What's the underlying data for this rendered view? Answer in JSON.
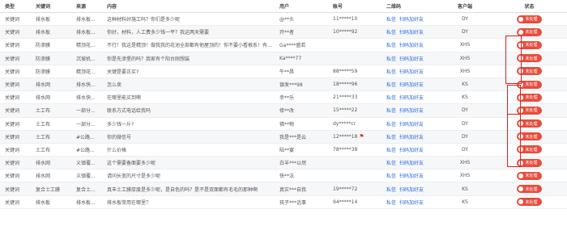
{
  "headers": {
    "type": "类型",
    "keyword": "关键词",
    "source": "来源",
    "content": "内容",
    "user": "用户",
    "account": "账号",
    "qrcode": "二维码",
    "client": "客户端",
    "status": "状态"
  },
  "actions": {
    "msg": "私信",
    "scan": "扫码加好友"
  },
  "status_label": "未处理",
  "highlight_color": "#e02020",
  "rows": [
    {
      "type": "关键词",
      "keyword": "排水板",
      "source": "排水板...",
      "content": "这种材料好施工吗？你们是多少呢",
      "user": "@**头",
      "account": "11*****10",
      "client": "DY"
    },
    {
      "type": "关键词",
      "keyword": "排水板",
      "source": "排水板...",
      "content": "你好，材料，人工费多少钱一平？我这两天需要",
      "user": "开**者",
      "account": "10*****92",
      "client": "DY"
    },
    {
      "type": "关键词",
      "keyword": "防渗膜",
      "source": "精顶花...",
      "content": "不行！我这是精顶！做我我的花池全部都有他屋顶的！你不要小看根系！有个商品房的精顶，一个房主他花了好多钱给吉...",
      "user": "Ga****盛若",
      "account": "",
      "client": "XHS"
    },
    {
      "type": "关键词",
      "keyword": "防渗膜",
      "source": "沉坡机...",
      "content": "你是先渗堡的吗？我家有个阳台刚想装",
      "user": "Ka****77",
      "account": "",
      "client": "XHS"
    },
    {
      "type": "关键词",
      "keyword": "防渗膜",
      "source": "精顶花...",
      "content": "关键是要正买?",
      "user": "午**昌",
      "account": "88*****59",
      "client": "XHS"
    },
    {
      "type": "关键词",
      "keyword": "排水网",
      "source": "排水快...",
      "content": "怎么卖",
      "user": "银发***98",
      "account": "18*****96",
      "client": "KS"
    },
    {
      "type": "关键词",
      "keyword": "排水网",
      "source": "排水快...",
      "content": "在哪里能买到啊",
      "user": "幸**乐",
      "account": "21*****33",
      "client": "KS"
    },
    {
      "type": "关键词",
      "keyword": "土工布",
      "source": "一部分...",
      "content": "联系方式电话给我吗",
      "user": "修**改",
      "account": "15*****22",
      "client": "DY"
    },
    {
      "type": "关键词",
      "keyword": "土工布",
      "source": "一部分...",
      "content": "多少钱一斤?",
      "user": "佛**物",
      "account": "dy*****cr",
      "client": "DY"
    },
    {
      "type": "关键词",
      "keyword": "土工布",
      "source": "#公路...",
      "content": "你的微信号",
      "user": "我是***是云",
      "account": "12*****18",
      "client": "DY",
      "flag": true
    },
    {
      "type": "关键词",
      "keyword": "土工布",
      "source": "#公路...",
      "content": "什么价格",
      "user": "陆**宴",
      "account": "78*****38",
      "client": "DY"
    },
    {
      "type": "关键词",
      "keyword": "排水网",
      "source": "义镇覆...",
      "content": "这个需要备面要多少呢",
      "user": "白羊***以然",
      "account": "",
      "client": "XHS"
    },
    {
      "type": "关键词",
      "keyword": "排水网",
      "source": "义镇覆...",
      "content": "请问长宽的尺寸是多少呢",
      "user": "快**法",
      "account": "",
      "client": "XHS"
    },
    {
      "type": "关键词",
      "keyword": "复合土工膜",
      "source": "复合土...",
      "content": "真丰土工膜厚度是多少呢，是自色的吗？是不是双面都有毛毛的那种啊",
      "user": "真实***自我",
      "account": "19*****72",
      "client": "KS"
    },
    {
      "type": "关键词",
      "keyword": "排水板",
      "source": "排水板...",
      "content": "排水板常用在哪里？",
      "user": "孩子***话事",
      "account": "94*****14",
      "client": "KS"
    }
  ]
}
